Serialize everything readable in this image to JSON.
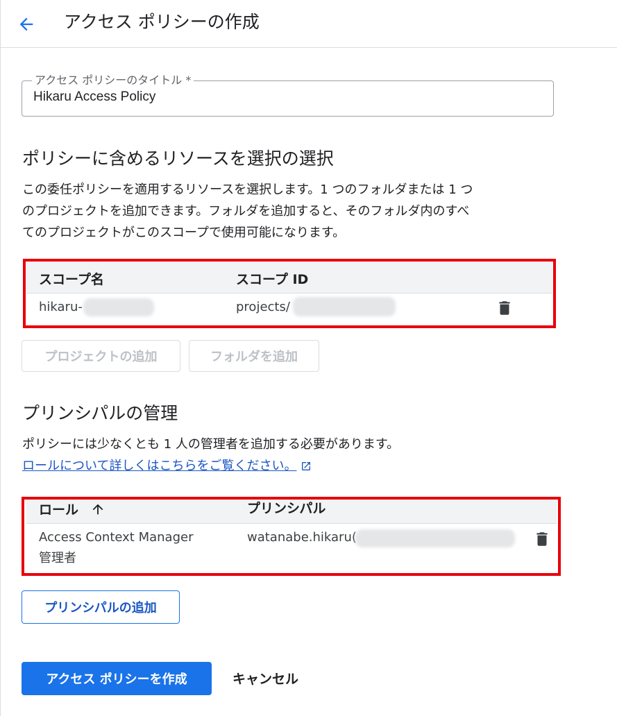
{
  "header": {
    "title": "アクセス ポリシーの作成"
  },
  "title_field": {
    "label": "アクセス ポリシーのタイトル *",
    "value": "Hikaru Access Policy"
  },
  "resources": {
    "heading": "ポリシーに含めるリソースを選択の選択",
    "description_lines": [
      "この委任ポリシーを適用するリソースを選択します。1 つのフォルダまたは 1 つ",
      "のプロジェクトを追加できます。フォルダを追加すると、そのフォルダ内のすべ",
      "てのプロジェクトがこのスコープで使用可能になります。"
    ],
    "columns": [
      "スコープ名",
      "スコープ ID"
    ],
    "rows": [
      {
        "name": "hikaru-",
        "id": "projects/"
      }
    ],
    "add_project_label": "プロジェクトの追加",
    "add_folder_label": "フォルダを追加"
  },
  "principals": {
    "heading": "プリンシパルの管理",
    "description": "ポリシーには少なくとも 1 人の管理者を追加する必要があります。",
    "link_text": "ロールについて詳しくはこちらをご覧ください。",
    "columns": [
      "ロール",
      "プリンシパル"
    ],
    "rows": [
      {
        "role_line1": "Access Context Manager",
        "role_line2": "管理者",
        "principal": "watanabe.hikaru("
      }
    ],
    "add_label": "プリンシパルの追加"
  },
  "footer": {
    "create_label": "アクセス ポリシーを作成",
    "cancel_label": "キャンセル"
  },
  "colors": {
    "primary": "#1a73e8",
    "highlight": "#e8000b"
  },
  "icons": [
    "back-arrow-icon",
    "trash-icon",
    "sort-up-arrow-icon",
    "external-link-icon"
  ]
}
